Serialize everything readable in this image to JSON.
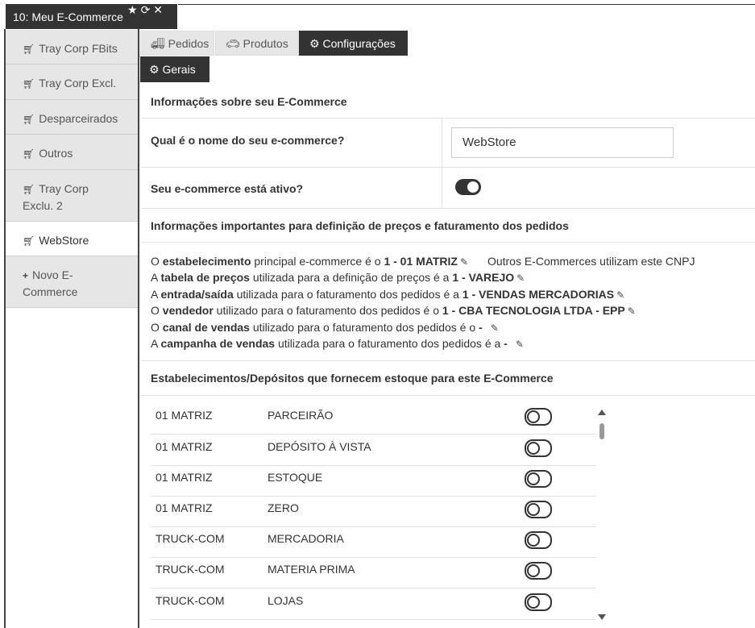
{
  "window": {
    "title": "10: Meu E-Commerce",
    "icons": [
      "star-icon",
      "refresh-icon",
      "close-icon"
    ]
  },
  "sidebar": {
    "items": [
      {
        "label": "Tray Corp FBits",
        "icon": "cart-icon",
        "active": false
      },
      {
        "label": "Tray Corp Excl.",
        "icon": "cart-icon",
        "active": false
      },
      {
        "label": "Desparceirados",
        "icon": "cart-icon",
        "active": false
      },
      {
        "label": "Outros",
        "icon": "cart-icon",
        "active": false
      },
      {
        "label": "Tray Corp Exclu. 2",
        "icon": "cart-icon",
        "active": false
      },
      {
        "label": "WebStore",
        "icon": "cart-icon",
        "active": true
      },
      {
        "label": "Novo E-Commerce",
        "icon": "plus-icon",
        "active": false
      }
    ]
  },
  "tabs": [
    {
      "label": "Pedidos",
      "icon": "truck-icon",
      "active": false
    },
    {
      "label": "Produtos",
      "icon": "car-icon",
      "active": false
    },
    {
      "label": "Configurações",
      "icon": "gears-icon",
      "active": true
    }
  ],
  "subtab": {
    "label": "Gerais",
    "icon": "gears-icon"
  },
  "info_section": {
    "title": "Informações sobre seu E-Commerce",
    "name_question": "Qual é o nome do seu e-commerce?",
    "name_value": "WebStore",
    "active_question": "Seu e-commerce está ativo?",
    "active": true
  },
  "pricing_section": {
    "title": "Informações importantes para definição de preços e faturamento dos pedidos",
    "lines": [
      {
        "pre": "O ",
        "key": "estabelecimento",
        "mid": " principal e-commerce é o ",
        "value": "1 - 01 MATRIZ",
        "extra": "Outros E-Commerces utilizam este CNPJ"
      },
      {
        "pre": "A ",
        "key": "tabela de preços",
        "mid": " utilizada para a definição de preços é a ",
        "value": "1 - VAREJO",
        "extra": ""
      },
      {
        "pre": "A ",
        "key": "entrada/saída",
        "mid": " utilizada para o faturamento dos pedidos é a ",
        "value": "1 - VENDAS MERCADORIAS",
        "extra": ""
      },
      {
        "pre": "O ",
        "key": "vendedor",
        "mid": " utilizado para o faturamento dos pedidos é o ",
        "value": "1 - CBA TECNOLOGIA LTDA - EPP",
        "extra": ""
      },
      {
        "pre": "O ",
        "key": "canal de vendas",
        "mid": " utilizado para o faturamento dos pedidos é o ",
        "value": "-",
        "extra": ""
      },
      {
        "pre": "A ",
        "key": "campanha de vendas",
        "mid": " utilizada para o faturamento dos pedidos é a ",
        "value": "-",
        "extra": ""
      }
    ]
  },
  "stock_section": {
    "title": "Estabelecimentos/Depósitos que fornecem estoque para este E-Commerce",
    "rows": [
      {
        "establishment": "01 MATRIZ",
        "deposit": "PARCEIRÃO",
        "enabled": false
      },
      {
        "establishment": "01 MATRIZ",
        "deposit": "DEPÓSITO À VISTA",
        "enabled": false
      },
      {
        "establishment": "01 MATRIZ",
        "deposit": "ESTOQUE",
        "enabled": false
      },
      {
        "establishment": "01 MATRIZ",
        "deposit": "ZERO",
        "enabled": false
      },
      {
        "establishment": "TRUCK-COM",
        "deposit": "MERCADORIA",
        "enabled": false
      },
      {
        "establishment": "TRUCK-COM",
        "deposit": "MATERIA PRIMA",
        "enabled": false
      },
      {
        "establishment": "TRUCK-COM",
        "deposit": "LOJAS",
        "enabled": false
      }
    ]
  }
}
